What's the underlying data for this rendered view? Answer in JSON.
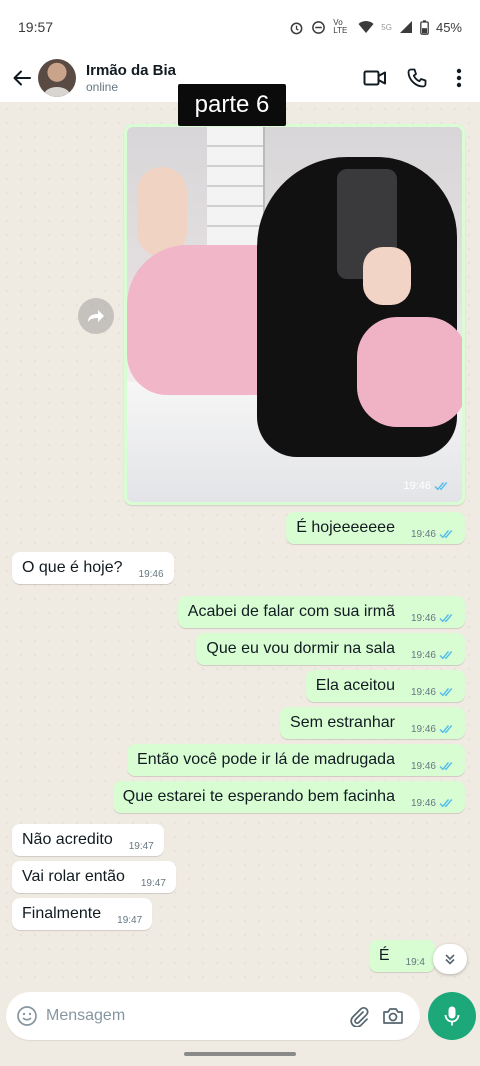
{
  "status_bar": {
    "time": "19:57",
    "network": "Vo LTE",
    "signal": "5G",
    "battery": "45%"
  },
  "header": {
    "contact_name": "Irmão da Bia",
    "contact_status": "online"
  },
  "overlay": {
    "label": "parte 6"
  },
  "photo_message": {
    "time": "19:46"
  },
  "messages": [
    {
      "dir": "out",
      "text": "É hojeeeeeee",
      "time": "19:46"
    },
    {
      "dir": "in",
      "text": "O que é hoje?",
      "time": "19:46"
    },
    {
      "dir": "out",
      "text": "Acabei de falar com sua irmã",
      "time": "19:46"
    },
    {
      "dir": "out",
      "text": "Que eu vou dormir na sala",
      "time": "19:46"
    },
    {
      "dir": "out",
      "text": "Ela aceitou",
      "time": "19:46"
    },
    {
      "dir": "out",
      "text": "Sem estranhar",
      "time": "19:46"
    },
    {
      "dir": "out",
      "text": "Então você pode ir lá de madrugada",
      "time": "19:46"
    },
    {
      "dir": "out",
      "text": "Que estarei te esperando bem facinha",
      "time": "19:46"
    },
    {
      "dir": "in",
      "text": "Não acredito",
      "time": "19:47"
    },
    {
      "dir": "in",
      "text": "Vai rolar então",
      "time": "19:47"
    },
    {
      "dir": "in",
      "text": "Finalmente",
      "time": "19:47"
    },
    {
      "dir": "out",
      "text": "É",
      "time": "19:4"
    }
  ],
  "composer": {
    "placeholder": "Mensagem"
  },
  "colors": {
    "accent": "#1da87a",
    "outgoing_bubble": "#d9fdd3",
    "incoming_bubble": "#ffffff",
    "read_ticks": "#53bdeb",
    "chat_background": "#efeae2"
  }
}
